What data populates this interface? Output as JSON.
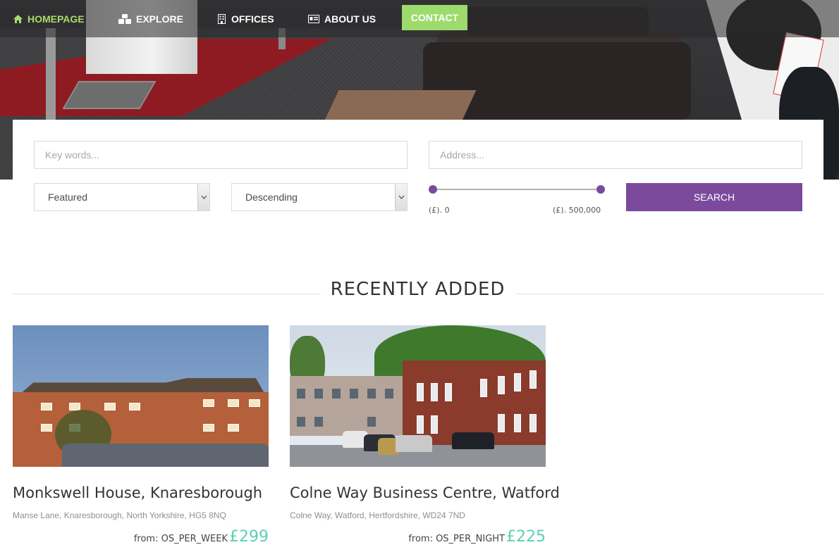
{
  "colors": {
    "accent_green": "#9ddb6d",
    "active_nav": "#a6dc6a",
    "purple": "#7b4a9d",
    "price_teal": "#5ecfb0"
  },
  "nav": {
    "items": [
      {
        "label": "Homepage",
        "icon": "home-icon",
        "active": true
      },
      {
        "label": "Explore",
        "icon": "cubes-icon",
        "active": false
      },
      {
        "label": "Offices",
        "icon": "building-icon",
        "active": false
      },
      {
        "label": "About us",
        "icon": "id-card-icon",
        "active": false
      }
    ],
    "contact_label": "Contact"
  },
  "search": {
    "keywords_placeholder": "Key words...",
    "address_placeholder": "Address...",
    "sort_field": "Featured",
    "sort_order": "Descending",
    "price_min_label": "(£). 0",
    "price_max_label": "(£). 500,000",
    "button_label": "SEARCH"
  },
  "section": {
    "title": "RECENTLY ADDED"
  },
  "listings": [
    {
      "title": "Monkswell House, Knaresborough",
      "address": "Manse Lane, Knaresborough, North Yorkshire, HG5 8NQ",
      "from_label": "from: OS_PER_WEEK",
      "price": "£299"
    },
    {
      "title": "Colne Way Business Centre, Watford",
      "address": "Colne Way, Watford, Hertfordshire, WD24 7ND",
      "from_label": "from: OS_PER_NIGHT",
      "price": "£225"
    }
  ]
}
